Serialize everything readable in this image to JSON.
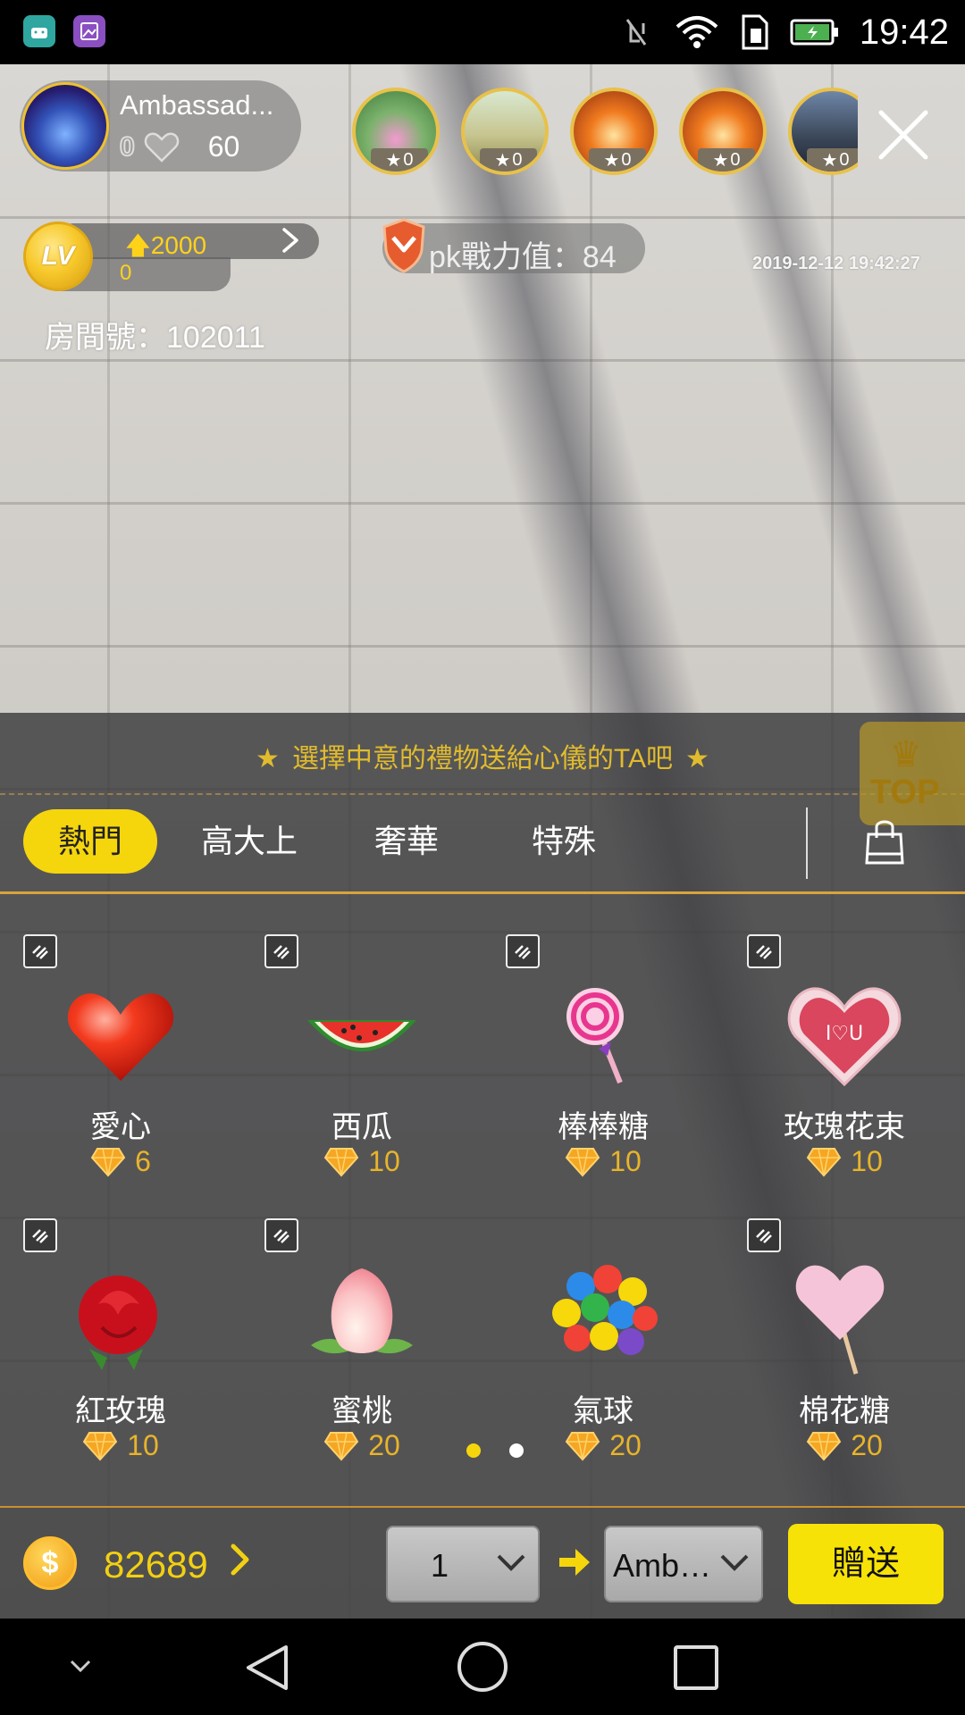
{
  "status_bar": {
    "time": "19:42",
    "icons": [
      "android-debug-icon",
      "gallery-app-icon",
      "vibrate-off-icon",
      "wifi-icon",
      "sim-icon",
      "battery-charging-icon"
    ]
  },
  "host": {
    "name": "Ambassad...",
    "fans": "0",
    "likes": "60"
  },
  "viewers": [
    {
      "stars": "0"
    },
    {
      "stars": "0"
    },
    {
      "stars": "0"
    },
    {
      "stars": "0"
    },
    {
      "stars": "0"
    }
  ],
  "level": {
    "badge": "LV",
    "next_value": "2000",
    "current_value": "0"
  },
  "pk": {
    "label": "pk戰力值：",
    "value": "84"
  },
  "timestamp": "2019-12-12 19:42:27",
  "room": {
    "label": "房間號：",
    "number": "102011"
  },
  "gift_panel": {
    "hint": "選擇中意的禮物送給心儀的TA吧",
    "top_label": "TOP",
    "tabs": [
      {
        "label": "熱門",
        "active": true
      },
      {
        "label": "高大上",
        "active": false
      },
      {
        "label": "奢華",
        "active": false
      },
      {
        "label": "特殊",
        "active": false
      }
    ],
    "gifts": [
      {
        "name": "愛心",
        "price": "6"
      },
      {
        "name": "西瓜",
        "price": "10"
      },
      {
        "name": "棒棒糖",
        "price": "10"
      },
      {
        "name": "玫瑰花束",
        "price": "10"
      },
      {
        "name": "紅玫瑰",
        "price": "10"
      },
      {
        "name": "蜜桃",
        "price": "20"
      },
      {
        "name": "氣球",
        "price": "20"
      },
      {
        "name": "棉花糖",
        "price": "20"
      }
    ],
    "page_count": 2,
    "current_page": 1
  },
  "bottom_bar": {
    "balance": "82689",
    "quantity": "1",
    "recipient": "Amba...",
    "send_label": "贈送"
  },
  "colors": {
    "accent_yellow": "#f5d60d",
    "gold_text": "#e1bb2e",
    "price_orange": "#e8b42a"
  }
}
